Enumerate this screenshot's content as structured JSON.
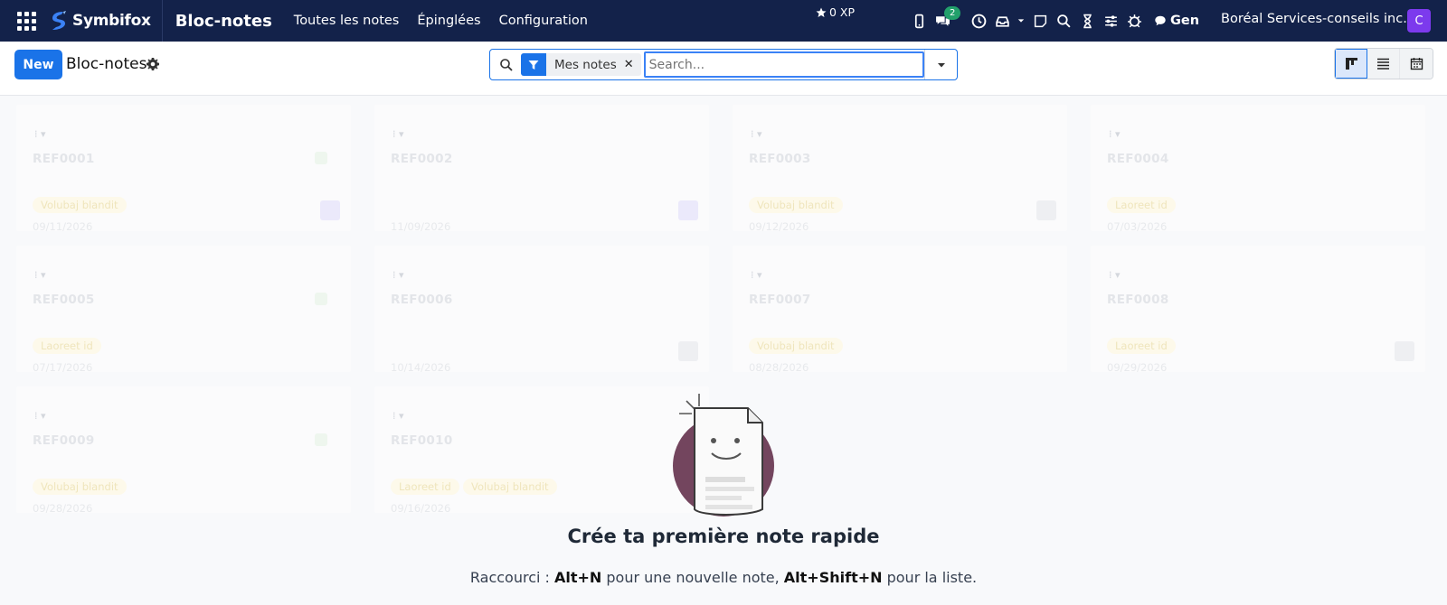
{
  "navbar": {
    "brand": "Symbifox",
    "app_title": "Bloc-notes",
    "menu": [
      "Toutes les notes",
      "Épinglées",
      "Configuration"
    ],
    "xp": "0 XP",
    "chat_badge": "2",
    "gen_label": "Gen",
    "company": "Boréal Services-conseils inc.",
    "avatar_letter": "C"
  },
  "control_panel": {
    "new_label": "New",
    "breadcrumb": "Bloc-notes",
    "facet_label": "Mes notes",
    "search_placeholder": "Search..."
  },
  "cards": [
    {
      "ref": "REF0001",
      "tags": [
        "Volubaj blandit"
      ],
      "date": "09/11/2026"
    },
    {
      "ref": "REF0002",
      "tags": [],
      "date": "11/09/2026"
    },
    {
      "ref": "REF0003",
      "tags": [
        "Volubaj blandit"
      ],
      "date": "09/12/2026"
    },
    {
      "ref": "REF0004",
      "tags": [
        "Laoreet id"
      ],
      "date": "07/03/2026"
    },
    {
      "ref": "REF0005",
      "tags": [
        "Laoreet id"
      ],
      "date": "07/17/2026"
    },
    {
      "ref": "REF0006",
      "tags": [],
      "date": "10/14/2026"
    },
    {
      "ref": "REF0007",
      "tags": [
        "Volubaj blandit"
      ],
      "date": "08/28/2026"
    },
    {
      "ref": "REF0008",
      "tags": [
        "Laoreet id"
      ],
      "date": "09/29/2026"
    },
    {
      "ref": "REF0009",
      "tags": [
        "Volubaj blandit"
      ],
      "date": "09/28/2026"
    },
    {
      "ref": "REF0010",
      "tags": [
        "Laoreet id",
        "Volubaj blandit"
      ],
      "date": "09/16/2026"
    }
  ],
  "helper": {
    "title": "Crée ta première note rapide",
    "sub_prefix": "Raccourci : ",
    "shortcut_1": "Alt+N",
    "sub_middle": " pour une nouvelle note, ",
    "shortcut_2": "Alt+Shift+N",
    "sub_suffix": " pour la liste."
  },
  "colors": {
    "navbar": "#13224a",
    "primary": "#1a73e8",
    "avatar": "#7c3aed"
  }
}
